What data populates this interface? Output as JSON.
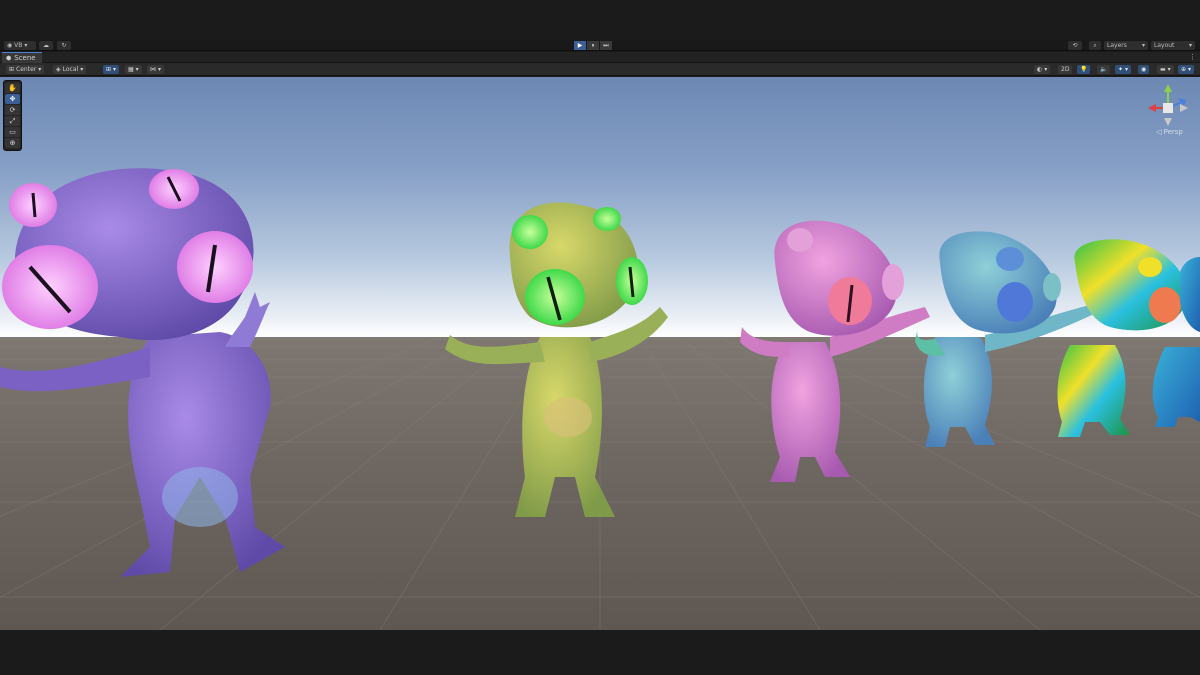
{
  "main_toolbar": {
    "account_label": "VB",
    "play_buttons": [
      "▶",
      "⏸",
      "⏭"
    ],
    "layers_label": "Layers",
    "layout_label": "Layout"
  },
  "scene_tab": {
    "label": "Scene",
    "menu_icon": "more-vertical-icon"
  },
  "scene_toolbar": {
    "pivot_label": "Center",
    "space_label": "Local",
    "mode_2d_label": "2D"
  },
  "tools": [
    "hand-tool-icon",
    "move-tool-icon",
    "rotate-tool-icon",
    "scale-tool-icon",
    "rect-tool-icon",
    "transform-tool-icon"
  ],
  "gizmo": {
    "projection_label": "◁ Persp",
    "axes": [
      "y",
      "x",
      "z"
    ]
  },
  "creatures": [
    {
      "name": "purple-alien",
      "colors": [
        "#7b61c4",
        "#a98ae8",
        "#e07ee6",
        "#8fb7ea"
      ]
    },
    {
      "name": "green-alien",
      "colors": [
        "#a9c24a",
        "#7fa35a",
        "#3fd94a",
        "#d8c07a"
      ]
    },
    {
      "name": "pink-alien",
      "colors": [
        "#d66fc7",
        "#e4a0d8",
        "#f06e9a",
        "#9b6fbf"
      ]
    },
    {
      "name": "teal-alien",
      "colors": [
        "#5d9fc9",
        "#7bbfc7",
        "#4f78d8",
        "#5dc0a6"
      ]
    },
    {
      "name": "rainbow-alien",
      "colors": [
        "#2fc04a",
        "#f0e02a",
        "#2ac0e0",
        "#f07a50"
      ]
    },
    {
      "name": "blue-alien",
      "colors": [
        "#2a78c8",
        "#3ab0d8",
        "#1e60b0",
        "#48c0c0"
      ]
    }
  ]
}
